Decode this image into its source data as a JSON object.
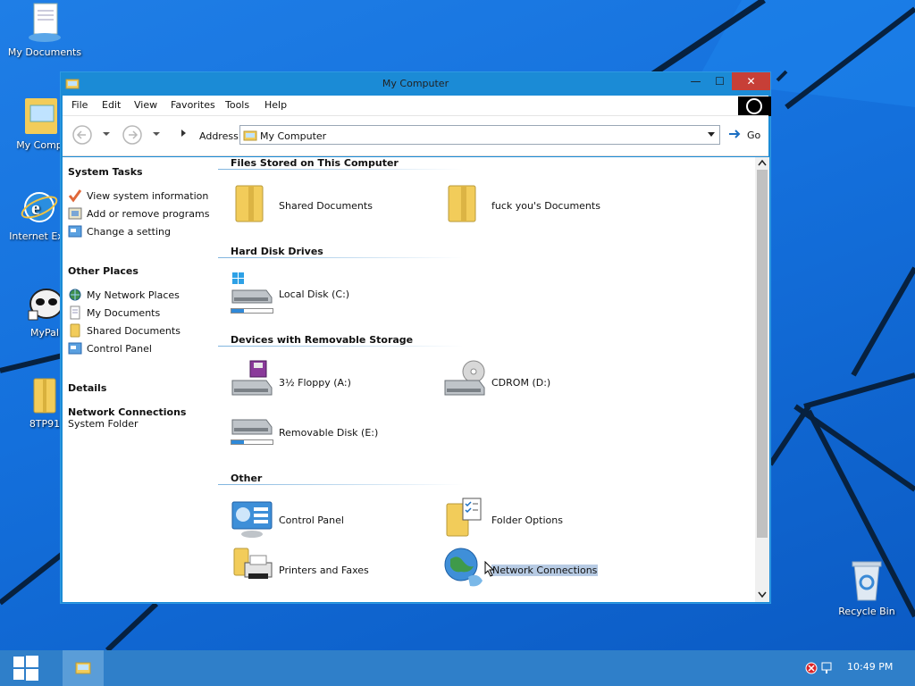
{
  "desktop": {
    "icons": [
      {
        "label": "My Documents"
      },
      {
        "label": "My Comp"
      },
      {
        "label": "Internet Exp"
      },
      {
        "label": "MyPal"
      },
      {
        "label": "8TP91"
      },
      {
        "label": "Recycle Bin"
      }
    ]
  },
  "window": {
    "title": "My Computer",
    "menu": [
      "File",
      "Edit",
      "View",
      "Favorites",
      "Tools",
      "Help"
    ],
    "address_label": "Address",
    "address_value": "My Computer",
    "go_label": "Go"
  },
  "taskpane": {
    "system_tasks": {
      "heading": "System Tasks",
      "items": [
        "View system information",
        "Add or remove programs",
        "Change a setting"
      ]
    },
    "other_places": {
      "heading": "Other Places",
      "items": [
        "My Network Places",
        "My Documents",
        "Shared Documents",
        "Control Panel"
      ]
    },
    "details": {
      "heading": "Details",
      "name": "Network Connections",
      "type": "System Folder"
    }
  },
  "content": {
    "groups": [
      {
        "heading": "Files Stored on This Computer",
        "items": [
          "Shared Documents",
          "fuck you's Documents"
        ]
      },
      {
        "heading": "Hard Disk Drives",
        "items": [
          "Local Disk (C:)"
        ]
      },
      {
        "heading": "Devices with Removable Storage",
        "items": [
          "3½ Floppy (A:)",
          "CDROM (D:)",
          "Removable Disk (E:)"
        ]
      },
      {
        "heading": "Other",
        "items": [
          "Control Panel",
          "Folder Options",
          "Printers and Faxes",
          "Network Connections"
        ]
      }
    ],
    "selected_item": "Network Connections",
    "drive_usage": {
      "local_disk_c": 0.3,
      "removable_disk_e": 0.3
    }
  },
  "taskbar": {
    "clock": "10:49 PM"
  },
  "colors": {
    "accent": "#1b8bd6",
    "close": "#c73f37",
    "taskbar": "#2f7fc9",
    "selection": "#b7cbe4"
  }
}
